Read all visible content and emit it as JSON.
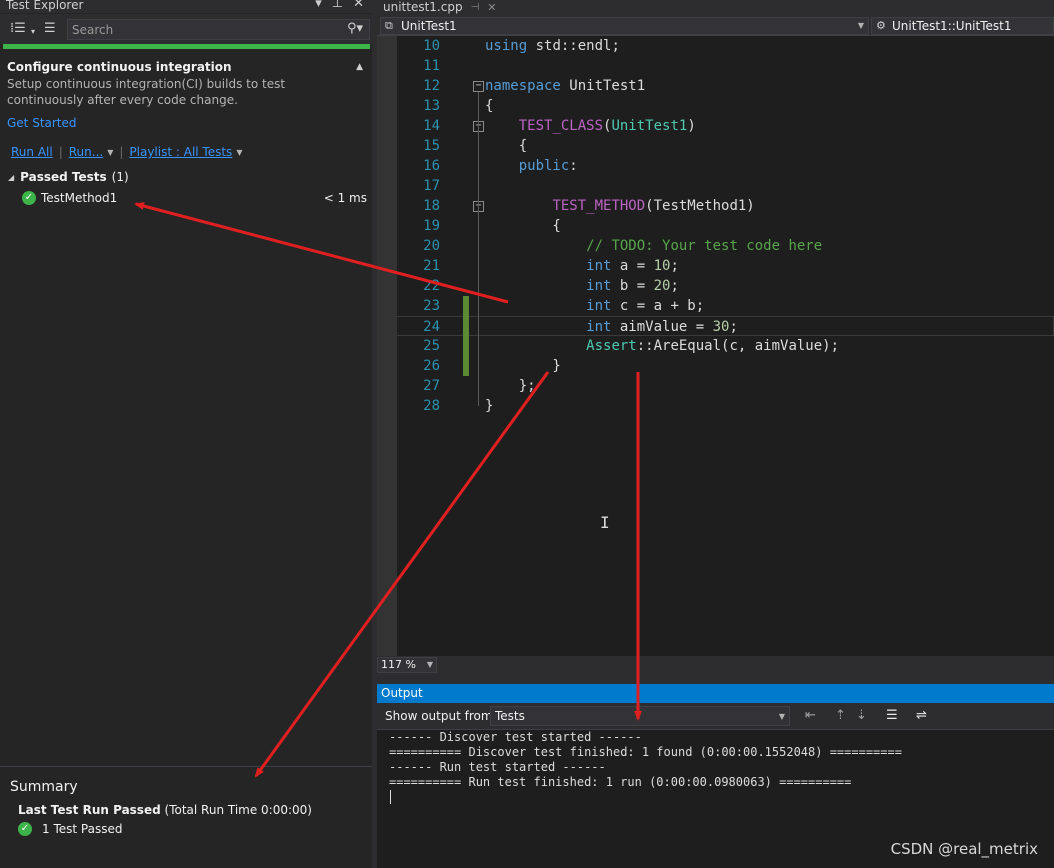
{
  "test_explorer": {
    "title": "Test Explorer",
    "search_placeholder": "Search",
    "ci": {
      "title": "Configure continuous integration",
      "text": "Setup continuous integration(CI) builds to test continuously after every code change.",
      "link": "Get Started"
    },
    "run_bar": {
      "run_all": "Run All",
      "run": "Run...",
      "playlist": "Playlist : All Tests"
    },
    "group": {
      "name": "Passed Tests",
      "count": "(1)"
    },
    "tests": [
      {
        "name": "TestMethod1",
        "duration": "< 1 ms",
        "status": "passed"
      }
    ],
    "summary": {
      "title": "Summary",
      "last_run": "Last Test Run Passed",
      "total_time": "(Total Run Time 0:00:00)",
      "passed": "1 Test Passed"
    }
  },
  "editor": {
    "tab": "unittest1.cpp",
    "nav_left": "UnitTest1",
    "nav_right": "UnitTest1::UnitTest1",
    "zoom": "117 %",
    "lines": [
      {
        "n": "10",
        "tokens": [
          [
            "k",
            "using"
          ],
          [
            "p",
            " std::endl;"
          ]
        ]
      },
      {
        "n": "11",
        "tokens": []
      },
      {
        "n": "12",
        "tokens": [
          [
            "k",
            "namespace"
          ],
          [
            "p",
            " UnitTest1"
          ]
        ]
      },
      {
        "n": "13",
        "tokens": [
          [
            "p",
            "{"
          ]
        ]
      },
      {
        "n": "14",
        "tokens": [
          [
            "p",
            "    "
          ],
          [
            "m",
            "TEST_CLASS"
          ],
          [
            "p",
            "("
          ],
          [
            "t",
            "UnitTest1"
          ],
          [
            "p",
            ")"
          ]
        ]
      },
      {
        "n": "15",
        "tokens": [
          [
            "p",
            "    {"
          ]
        ]
      },
      {
        "n": "16",
        "tokens": [
          [
            "p",
            "    "
          ],
          [
            "k",
            "public"
          ],
          [
            "p",
            ":"
          ]
        ]
      },
      {
        "n": "17",
        "tokens": []
      },
      {
        "n": "18",
        "tokens": [
          [
            "p",
            "        "
          ],
          [
            "m",
            "TEST_METHOD"
          ],
          [
            "p",
            "(TestMethod1)"
          ]
        ]
      },
      {
        "n": "19",
        "tokens": [
          [
            "p",
            "        {"
          ]
        ]
      },
      {
        "n": "20",
        "tokens": [
          [
            "p",
            "            "
          ],
          [
            "c",
            "// TODO: Your test code here"
          ]
        ]
      },
      {
        "n": "21",
        "tokens": [
          [
            "p",
            "            "
          ],
          [
            "k",
            "int"
          ],
          [
            "p",
            " a = "
          ],
          [
            "n",
            "10"
          ],
          [
            "p",
            ";"
          ]
        ]
      },
      {
        "n": "22",
        "tokens": [
          [
            "p",
            "            "
          ],
          [
            "k",
            "int"
          ],
          [
            "p",
            " b = "
          ],
          [
            "n",
            "20"
          ],
          [
            "p",
            ";"
          ]
        ]
      },
      {
        "n": "23",
        "tokens": [
          [
            "p",
            "            "
          ],
          [
            "k",
            "int"
          ],
          [
            "p",
            " c = a + b;"
          ]
        ]
      },
      {
        "n": "24",
        "tokens": [
          [
            "p",
            "            "
          ],
          [
            "k",
            "int"
          ],
          [
            "p",
            " aimValue = "
          ],
          [
            "n",
            "30"
          ],
          [
            "p",
            ";"
          ]
        ]
      },
      {
        "n": "25",
        "tokens": [
          [
            "p",
            "            "
          ],
          [
            "t",
            "Assert"
          ],
          [
            "p",
            "::AreEqual(c, aimValue);"
          ]
        ]
      },
      {
        "n": "26",
        "tokens": [
          [
            "p",
            "        }"
          ]
        ]
      },
      {
        "n": "27",
        "tokens": [
          [
            "p",
            "    };"
          ]
        ]
      },
      {
        "n": "28",
        "tokens": [
          [
            "p",
            "}"
          ]
        ]
      }
    ]
  },
  "output": {
    "title": "Output",
    "show_from_label": "Show output from:",
    "source": "Tests",
    "lines": [
      "------ Discover test started ------",
      "========== Discover test finished: 1 found (0:00:00.1552048) ==========",
      "------ Run test started ------",
      "========== Run test finished: 1 run (0:00:00.0980063) =========="
    ]
  },
  "watermark": "CSDN @real_metrix",
  "colors": {
    "accent": "#007acc",
    "pass": "#3cb449",
    "arrow": "#e02020"
  }
}
